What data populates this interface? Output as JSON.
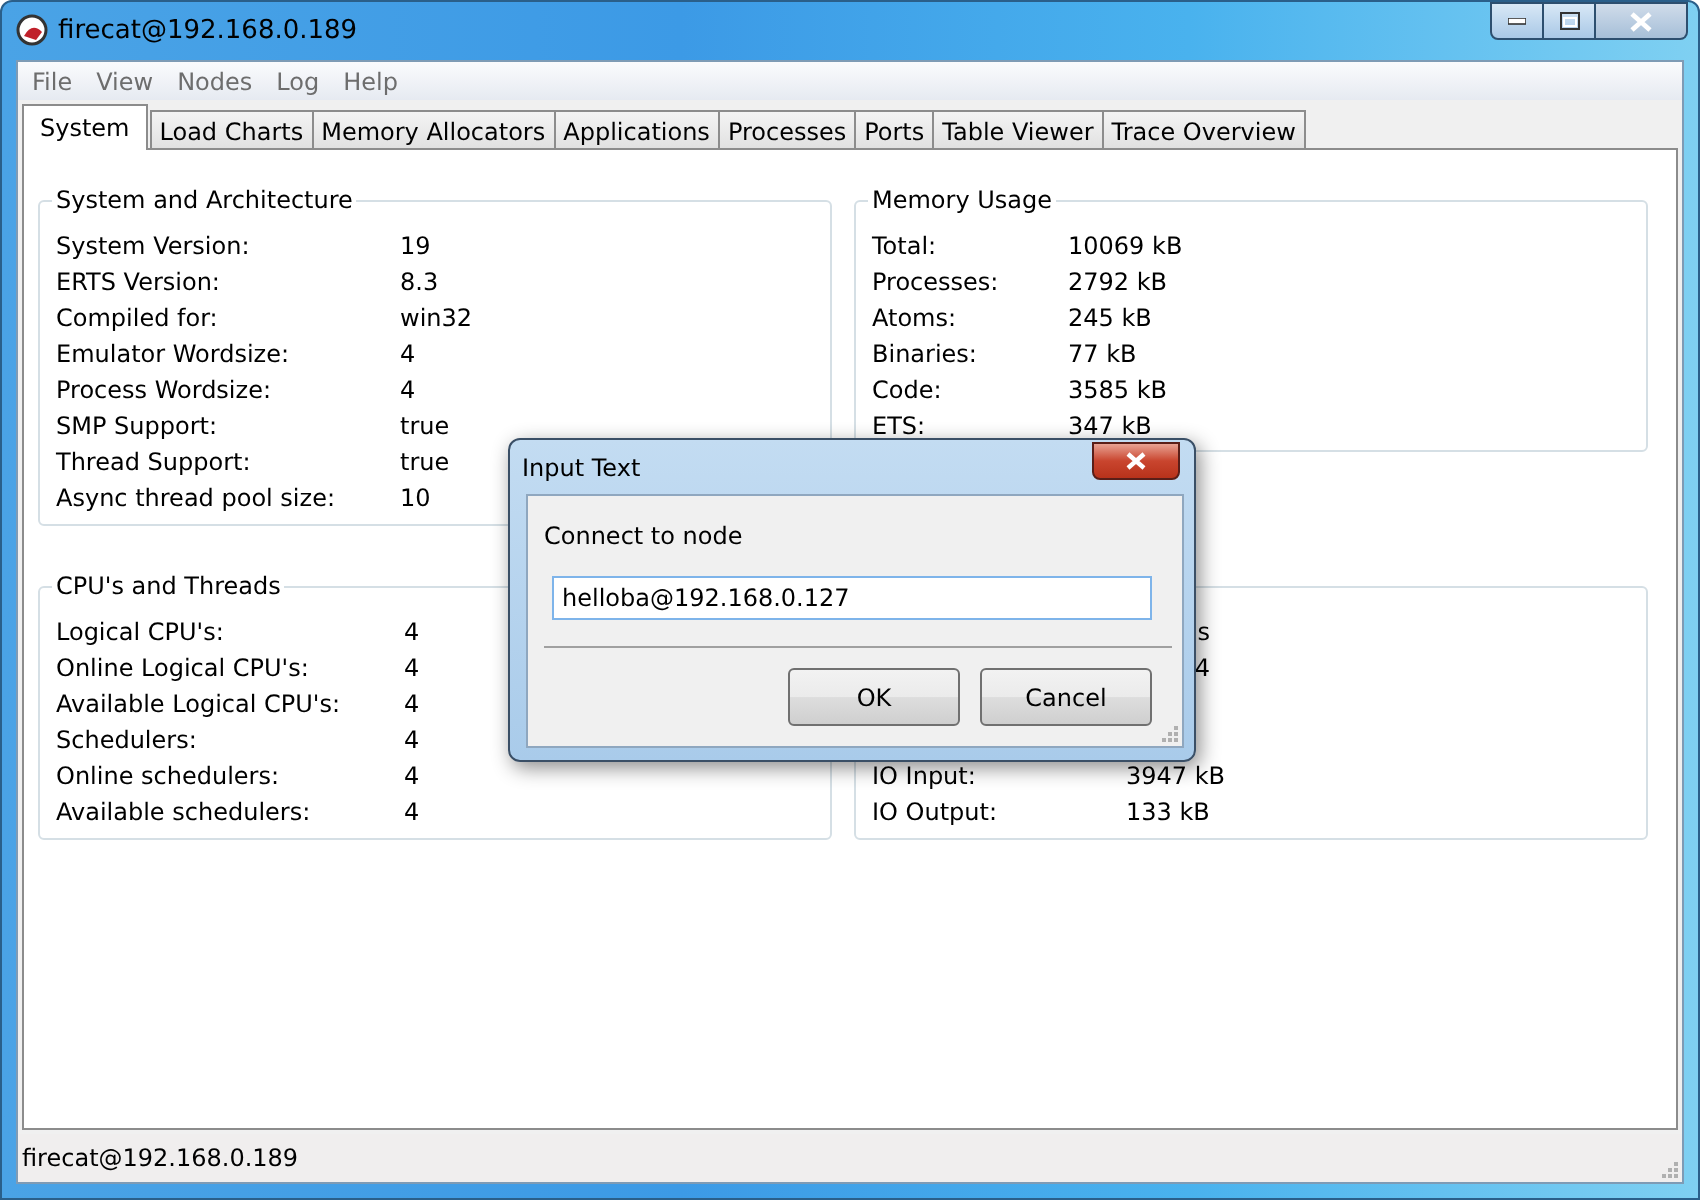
{
  "window": {
    "title": "firecat@192.168.0.189"
  },
  "menu": [
    "File",
    "View",
    "Nodes",
    "Log",
    "Help"
  ],
  "tabs": [
    {
      "label": "System",
      "selected": true
    },
    {
      "label": "Load Charts",
      "selected": false
    },
    {
      "label": "Memory Allocators",
      "selected": false
    },
    {
      "label": "Applications",
      "selected": false
    },
    {
      "label": "Processes",
      "selected": false
    },
    {
      "label": "Ports",
      "selected": false
    },
    {
      "label": "Table Viewer",
      "selected": false
    },
    {
      "label": "Trace Overview",
      "selected": false
    }
  ],
  "panels": [
    {
      "title": "System and Architecture",
      "rows": [
        {
          "label": "System Version:",
          "value": "19"
        },
        {
          "label": "ERTS Version:",
          "value": "8.3"
        },
        {
          "label": "Compiled for:",
          "value": "win32"
        },
        {
          "label": "Emulator Wordsize:",
          "value": "4"
        },
        {
          "label": "Process Wordsize:",
          "value": "4"
        },
        {
          "label": "SMP Support:",
          "value": "true"
        },
        {
          "label": "Thread Support:",
          "value": "true"
        },
        {
          "label": "Async thread pool size:",
          "value": "10"
        }
      ]
    },
    {
      "title": "Memory Usage",
      "rows": [
        {
          "label": "Total:",
          "value": "10069 kB"
        },
        {
          "label": "Processes:",
          "value": "2792 kB"
        },
        {
          "label": "Atoms:",
          "value": "245 kB"
        },
        {
          "label": "Binaries:",
          "value": "77 kB"
        },
        {
          "label": "Code:",
          "value": "3585 kB"
        },
        {
          "label": "ETS:",
          "value": "347 kB"
        }
      ]
    },
    {
      "title": "CPU's and Threads",
      "rows": [
        {
          "label": "Logical CPU's:",
          "value": "4"
        },
        {
          "label": "Online Logical CPU's:",
          "value": "4"
        },
        {
          "label": "Available Logical CPU's:",
          "value": "4"
        },
        {
          "label": "Schedulers:",
          "value": "4"
        },
        {
          "label": "Online schedulers:",
          "value": "4"
        },
        {
          "label": "Available schedulers:",
          "value": "4"
        }
      ]
    },
    {
      "covered_rows": [
        {
          "value": "s"
        },
        {
          "value": "4"
        }
      ],
      "rows": [
        {
          "label": "IO Input:",
          "value": "3947 kB"
        },
        {
          "label": "IO Output:",
          "value": "133 kB"
        }
      ]
    }
  ],
  "dialog": {
    "title": "Input Text",
    "prompt": "Connect to node",
    "value": "helloba@192.168.0.127",
    "buttons": [
      "OK",
      "Cancel"
    ]
  },
  "status_bar": "firecat@192.168.0.189"
}
